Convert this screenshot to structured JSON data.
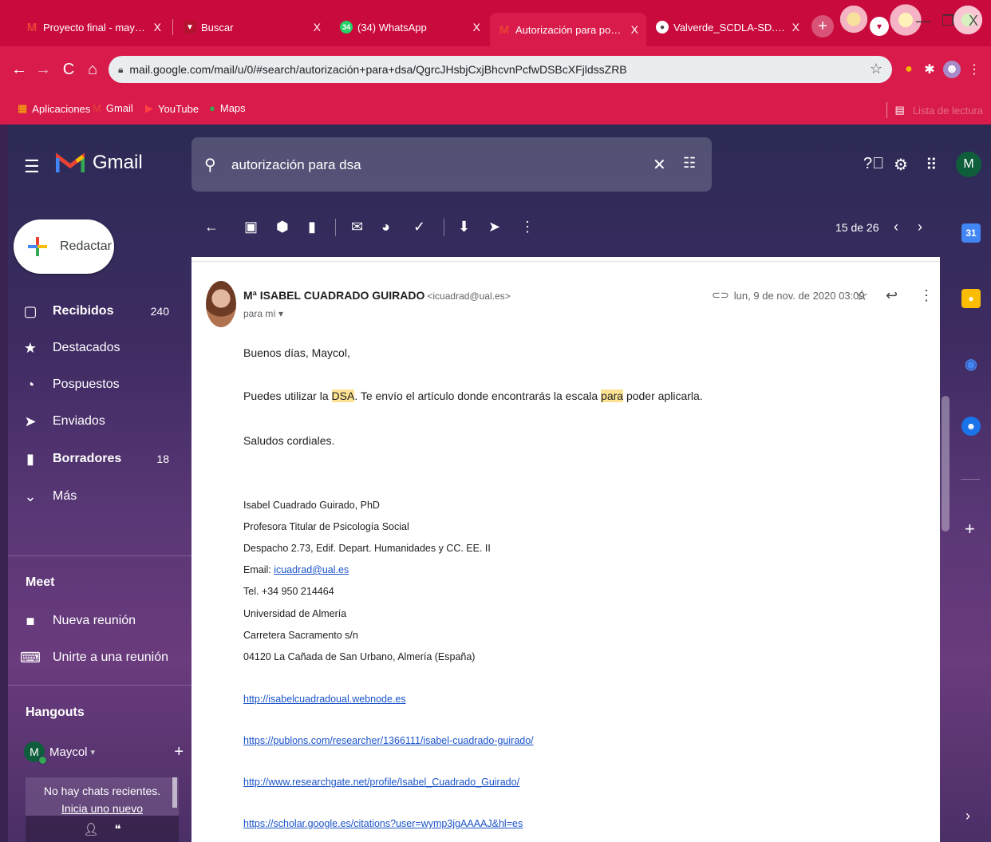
{
  "browser": {
    "tabs": [
      {
        "label": "Proyecto final - maycol.alfaro",
        "icon": "gmail-icon"
      },
      {
        "label": "Buscar",
        "icon": "buscar-icon"
      },
      {
        "label": "(34) WhatsApp",
        "icon": "whatsapp-icon",
        "badge": "34"
      },
      {
        "label": "Autorización para poder usar",
        "icon": "gmail-icon"
      },
      {
        "label": "Valverde_SCDLA-SD.pdf",
        "icon": "globe-icon"
      }
    ],
    "url": "mail.google.com/mail/u/0/#search/autorización+para+dsa/QgrcJHsbjCxjBhcvnPcfwDSBcXFjldssZRB",
    "bookmarks": [
      "Aplicaciones",
      "Gmail",
      "YouTube",
      "Maps"
    ],
    "reading_list": "Lista de lectura",
    "accent_color": "#d81b4a"
  },
  "gmail": {
    "app_name": "Gmail",
    "search": "autorización para dsa",
    "account_initial": "M",
    "compose_label": "Redactar",
    "nav": [
      {
        "label": "Recibidos",
        "count": "240",
        "bold": true
      },
      {
        "label": "Destacados",
        "count": ""
      },
      {
        "label": "Pospuestos",
        "count": ""
      },
      {
        "label": "Enviados",
        "count": ""
      },
      {
        "label": "Borradores",
        "count": "18",
        "bold": true
      },
      {
        "label": "Más",
        "count": ""
      }
    ],
    "meet": {
      "title": "Meet",
      "items": [
        "Nueva reunión",
        "Unirte a una reunión"
      ]
    },
    "hangouts": {
      "title": "Hangouts",
      "user": "Maycol",
      "user_initial": "M",
      "empty_line1": "No hay chats recientes.",
      "empty_line2": "Inicia uno nuevo"
    },
    "pager": "15 de 26"
  },
  "message": {
    "sender_name": "Mª ISABEL CUADRADO GUIRADO",
    "sender_email": "<icuadrad@ual.es>",
    "to": "para mí",
    "date": "lun, 9 de nov. de 2020 03:09",
    "greeting": "Buenos días, Maycol,",
    "body_a": "Puedes utilizar la ",
    "body_hl1": "DSA",
    "body_b": ". Te envío el artículo donde encontrarás la escala ",
    "body_hl2": "para",
    "body_c": " poder aplicarla.",
    "closing": "Saludos cordiales.",
    "signature": {
      "name": "Isabel Cuadrado Guirado, PhD",
      "position": "Profesora Titular de Psicología Social",
      "office": "Despacho 2.73, Edif. Depart. Humanidades y CC. EE. II",
      "email_label": "Email: ",
      "email": "icuadrad@ual.es",
      "phone": "Tel. +34 950 214464",
      "university": "Universidad de Almería",
      "street": "Carretera Sacramento s/n",
      "city": "04120 La Cañada de San Urbano, Almería (España)"
    },
    "links": [
      "http://isabelcuadradoual.webnode.es",
      "https://publons.com/researcher/1366111/isabel-cuadrado-guirado/",
      "http://www.researchgate.net/profile/Isabel_Cuadrado_Guirado/",
      "https://scholar.google.es/citations?user=wymp3jgAAAAJ&hl=es"
    ]
  }
}
